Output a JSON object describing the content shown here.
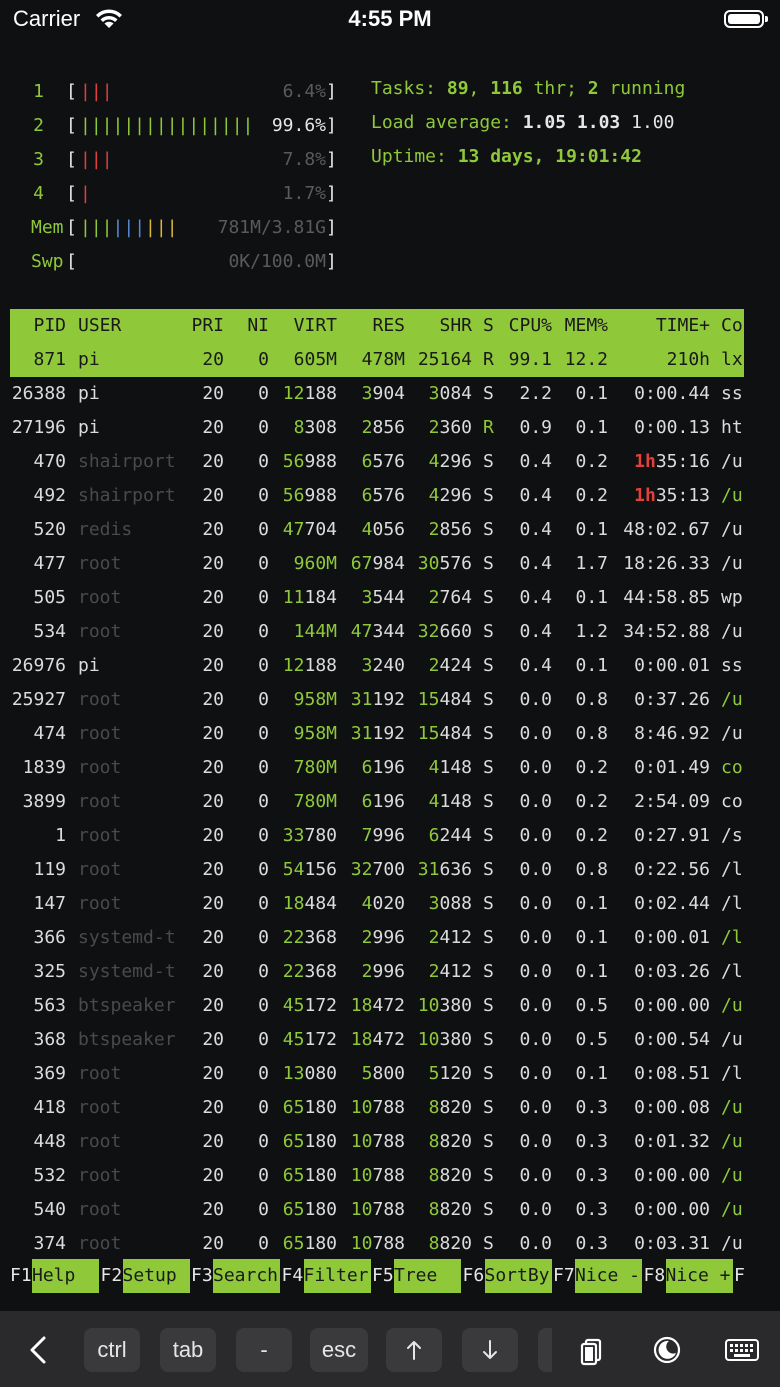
{
  "status_bar": {
    "carrier": "Carrier",
    "time": "4:55 PM"
  },
  "cpu_meters": [
    {
      "num": "1",
      "bars": [
        {
          "t": "|",
          "c": "red"
        },
        {
          "t": "|",
          "c": "red"
        },
        {
          "t": "|",
          "c": "red"
        }
      ],
      "value": "6.4%"
    },
    {
      "num": "2",
      "bars": [
        {
          "t": "||||||||||||||||",
          "c": "green"
        }
      ],
      "value": "99.6%"
    },
    {
      "num": "3",
      "bars": [
        {
          "t": "|",
          "c": "red"
        },
        {
          "t": "|",
          "c": "red"
        },
        {
          "t": "|",
          "c": "red"
        }
      ],
      "value": "7.8%"
    },
    {
      "num": "4",
      "bars": [
        {
          "t": "|",
          "c": "red"
        }
      ],
      "value": "1.7%"
    }
  ],
  "mem": {
    "label": "Mem",
    "bars": [
      {
        "t": "|||",
        "c": "green"
      },
      {
        "t": "|||",
        "c": "blue"
      },
      {
        "t": "|||",
        "c": "yellow"
      }
    ],
    "value": "781M/3.81G"
  },
  "swp": {
    "label": "Swp",
    "value": "0K/100.0M"
  },
  "tasks": {
    "label": "Tasks: ",
    "count": "89",
    "sep": ", ",
    "thr": "116",
    "thr_label": " thr; ",
    "running": "2",
    "running_label": " running"
  },
  "load": {
    "label": "Load average: ",
    "v1": "1.05",
    "v2": "1.03",
    "v3": "1.00"
  },
  "uptime": {
    "label": "Uptime: ",
    "value": "13 days, 19:01:42"
  },
  "columns": [
    "PID",
    "USER",
    "PRI",
    "NI",
    "VIRT",
    "RES",
    "SHR",
    "S",
    "CPU%",
    "MEM%",
    "TIME+",
    "Co"
  ],
  "processes": [
    {
      "pid": "871",
      "user": "pi",
      "pri": "20",
      "ni": "0",
      "virt": "605M",
      "res": "478M",
      "shr": "25164",
      "s": "R",
      "cpu": "99.1",
      "mem": "12.2",
      "time": "210h",
      "cmd": "lx",
      "sel": true
    },
    {
      "pid": "26388",
      "user": "pi",
      "pri": "20",
      "ni": "0",
      "virt": "12188",
      "res": "3904",
      "shr": "3084",
      "s": "S",
      "cpu": "2.2",
      "mem": "0.1",
      "time": "0:00.44",
      "cmd": "ss"
    },
    {
      "pid": "27196",
      "user": "pi",
      "pri": "20",
      "ni": "0",
      "virt": "8308",
      "res": "2856",
      "shr": "2360",
      "s": "R",
      "cpu": "0.9",
      "mem": "0.1",
      "time": "0:00.13",
      "cmd": "ht"
    },
    {
      "pid": "470",
      "user": "shairport",
      "pri": "20",
      "ni": "0",
      "virt": "56988",
      "res": "6576",
      "shr": "4296",
      "s": "S",
      "cpu": "0.4",
      "mem": "0.2",
      "time": "1h35:16",
      "cmd": "/u"
    },
    {
      "pid": "492",
      "user": "shairport",
      "pri": "20",
      "ni": "0",
      "virt": "56988",
      "res": "6576",
      "shr": "4296",
      "s": "S",
      "cpu": "0.4",
      "mem": "0.2",
      "time": "1h35:13",
      "cmd": "/u",
      "cmdgreen": true
    },
    {
      "pid": "520",
      "user": "redis",
      "pri": "20",
      "ni": "0",
      "virt": "47704",
      "res": "4056",
      "shr": "2856",
      "s": "S",
      "cpu": "0.4",
      "mem": "0.1",
      "time": "48:02.67",
      "cmd": "/u"
    },
    {
      "pid": "477",
      "user": "root",
      "pri": "20",
      "ni": "0",
      "virt": "960M",
      "res": "67984",
      "shr": "30576",
      "s": "S",
      "cpu": "0.4",
      "mem": "1.7",
      "time": "18:26.33",
      "cmd": "/u"
    },
    {
      "pid": "505",
      "user": "root",
      "pri": "20",
      "ni": "0",
      "virt": "11184",
      "res": "3544",
      "shr": "2764",
      "s": "S",
      "cpu": "0.4",
      "mem": "0.1",
      "time": "44:58.85",
      "cmd": "wp"
    },
    {
      "pid": "534",
      "user": "root",
      "pri": "20",
      "ni": "0",
      "virt": "144M",
      "res": "47344",
      "shr": "32660",
      "s": "S",
      "cpu": "0.4",
      "mem": "1.2",
      "time": "34:52.88",
      "cmd": "/u"
    },
    {
      "pid": "26976",
      "user": "pi",
      "pri": "20",
      "ni": "0",
      "virt": "12188",
      "res": "3240",
      "shr": "2424",
      "s": "S",
      "cpu": "0.4",
      "mem": "0.1",
      "time": "0:00.01",
      "cmd": "ss"
    },
    {
      "pid": "25927",
      "user": "root",
      "pri": "20",
      "ni": "0",
      "virt": "958M",
      "res": "31192",
      "shr": "15484",
      "s": "S",
      "cpu": "0.0",
      "mem": "0.8",
      "time": "0:37.26",
      "cmd": "/u",
      "cmdgreen": true
    },
    {
      "pid": "474",
      "user": "root",
      "pri": "20",
      "ni": "0",
      "virt": "958M",
      "res": "31192",
      "shr": "15484",
      "s": "S",
      "cpu": "0.0",
      "mem": "0.8",
      "time": "8:46.92",
      "cmd": "/u"
    },
    {
      "pid": "1839",
      "user": "root",
      "pri": "20",
      "ni": "0",
      "virt": "780M",
      "res": "6196",
      "shr": "4148",
      "s": "S",
      "cpu": "0.0",
      "mem": "0.2",
      "time": "0:01.49",
      "cmd": "co",
      "cmdgreen": true
    },
    {
      "pid": "3899",
      "user": "root",
      "pri": "20",
      "ni": "0",
      "virt": "780M",
      "res": "6196",
      "shr": "4148",
      "s": "S",
      "cpu": "0.0",
      "mem": "0.2",
      "time": "2:54.09",
      "cmd": "co"
    },
    {
      "pid": "1",
      "user": "root",
      "pri": "20",
      "ni": "0",
      "virt": "33780",
      "res": "7996",
      "shr": "6244",
      "s": "S",
      "cpu": "0.0",
      "mem": "0.2",
      "time": "0:27.91",
      "cmd": "/s"
    },
    {
      "pid": "119",
      "user": "root",
      "pri": "20",
      "ni": "0",
      "virt": "54156",
      "res": "32700",
      "shr": "31636",
      "s": "S",
      "cpu": "0.0",
      "mem": "0.8",
      "time": "0:22.56",
      "cmd": "/l"
    },
    {
      "pid": "147",
      "user": "root",
      "pri": "20",
      "ni": "0",
      "virt": "18484",
      "res": "4020",
      "shr": "3088",
      "s": "S",
      "cpu": "0.0",
      "mem": "0.1",
      "time": "0:02.44",
      "cmd": "/l"
    },
    {
      "pid": "366",
      "user": "systemd-t",
      "pri": "20",
      "ni": "0",
      "virt": "22368",
      "res": "2996",
      "shr": "2412",
      "s": "S",
      "cpu": "0.0",
      "mem": "0.1",
      "time": "0:00.01",
      "cmd": "/l",
      "cmdgreen": true
    },
    {
      "pid": "325",
      "user": "systemd-t",
      "pri": "20",
      "ni": "0",
      "virt": "22368",
      "res": "2996",
      "shr": "2412",
      "s": "S",
      "cpu": "0.0",
      "mem": "0.1",
      "time": "0:03.26",
      "cmd": "/l"
    },
    {
      "pid": "563",
      "user": "btspeaker",
      "pri": "20",
      "ni": "0",
      "virt": "45172",
      "res": "18472",
      "shr": "10380",
      "s": "S",
      "cpu": "0.0",
      "mem": "0.5",
      "time": "0:00.00",
      "cmd": "/u",
      "cmdgreen": true
    },
    {
      "pid": "368",
      "user": "btspeaker",
      "pri": "20",
      "ni": "0",
      "virt": "45172",
      "res": "18472",
      "shr": "10380",
      "s": "S",
      "cpu": "0.0",
      "mem": "0.5",
      "time": "0:00.54",
      "cmd": "/u"
    },
    {
      "pid": "369",
      "user": "root",
      "pri": "20",
      "ni": "0",
      "virt": "13080",
      "res": "5800",
      "shr": "5120",
      "s": "S",
      "cpu": "0.0",
      "mem": "0.1",
      "time": "0:08.51",
      "cmd": "/l"
    },
    {
      "pid": "418",
      "user": "root",
      "pri": "20",
      "ni": "0",
      "virt": "65180",
      "res": "10788",
      "shr": "8820",
      "s": "S",
      "cpu": "0.0",
      "mem": "0.3",
      "time": "0:00.08",
      "cmd": "/u",
      "cmdgreen": true
    },
    {
      "pid": "448",
      "user": "root",
      "pri": "20",
      "ni": "0",
      "virt": "65180",
      "res": "10788",
      "shr": "8820",
      "s": "S",
      "cpu": "0.0",
      "mem": "0.3",
      "time": "0:01.32",
      "cmd": "/u",
      "cmdgreen": true
    },
    {
      "pid": "532",
      "user": "root",
      "pri": "20",
      "ni": "0",
      "virt": "65180",
      "res": "10788",
      "shr": "8820",
      "s": "S",
      "cpu": "0.0",
      "mem": "0.3",
      "time": "0:00.00",
      "cmd": "/u",
      "cmdgreen": true
    },
    {
      "pid": "540",
      "user": "root",
      "pri": "20",
      "ni": "0",
      "virt": "65180",
      "res": "10788",
      "shr": "8820",
      "s": "S",
      "cpu": "0.0",
      "mem": "0.3",
      "time": "0:00.00",
      "cmd": "/u",
      "cmdgreen": true
    },
    {
      "pid": "374",
      "user": "root",
      "pri": "20",
      "ni": "0",
      "virt": "65180",
      "res": "10788",
      "shr": "8820",
      "s": "S",
      "cpu": "0.0",
      "mem": "0.3",
      "time": "0:03.31",
      "cmd": "/u"
    }
  ],
  "function_keys": [
    {
      "num": "F1",
      "label": "Help  "
    },
    {
      "num": "F2",
      "label": "Setup "
    },
    {
      "num": "F3",
      "label": "Search"
    },
    {
      "num": "F4",
      "label": "Filter"
    },
    {
      "num": "F5",
      "label": "Tree  "
    },
    {
      "num": "F6",
      "label": "SortBy"
    },
    {
      "num": "F7",
      "label": "Nice -"
    },
    {
      "num": "F8",
      "label": "Nice +"
    }
  ],
  "fkeys_tail": "F",
  "toolbar": {
    "keys": [
      "ctrl",
      "tab",
      "-",
      "esc"
    ],
    "icons": [
      "back-chevron-icon",
      "arrow-up-icon",
      "arrow-down-icon",
      "paste-icon",
      "moon-icon",
      "keyboard-icon"
    ]
  }
}
